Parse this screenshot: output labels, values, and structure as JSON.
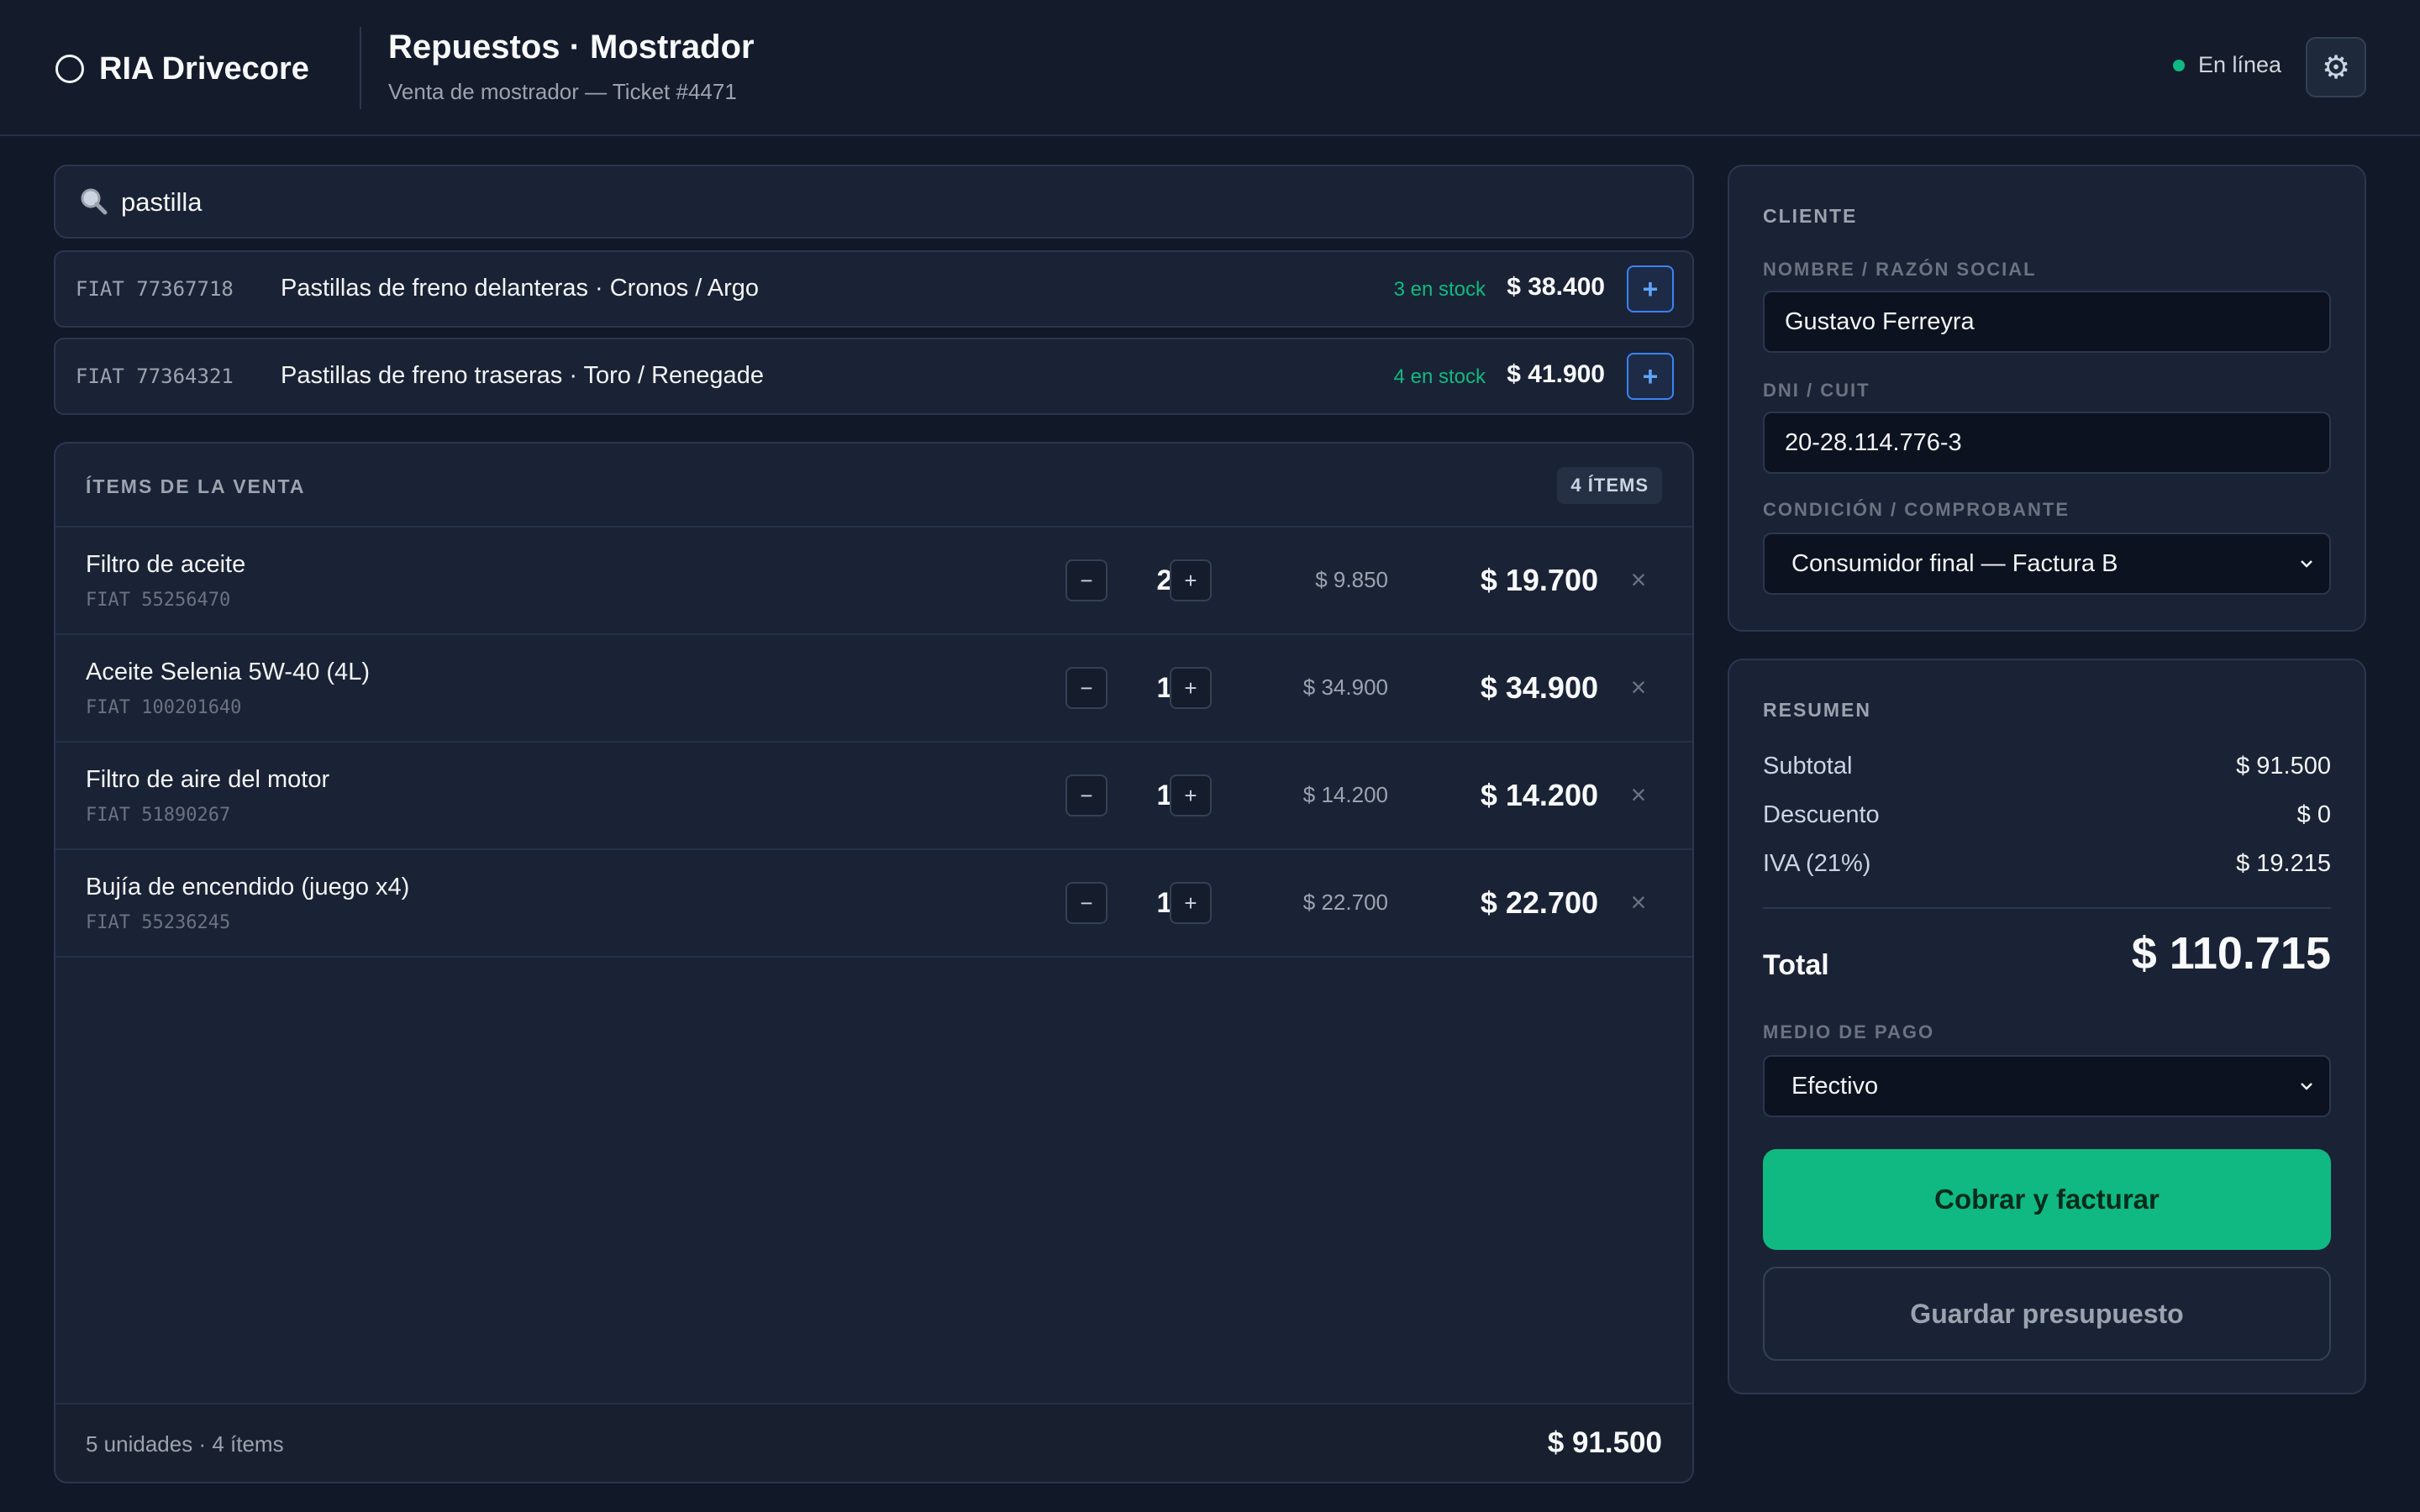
{
  "header": {
    "brand": "RIA Drivecore",
    "title": "Repuestos · Mostrador",
    "subtitle": "Venta de mostrador — Ticket #4471",
    "status": "En línea"
  },
  "search": {
    "value": "pastilla"
  },
  "results": [
    {
      "sku": "FIAT 77367718",
      "desc": "Pastillas de freno delanteras · Cronos / Argo",
      "stock": "3 en stock",
      "price": "$ 38.400",
      "add_label": "+"
    },
    {
      "sku": "FIAT 77364321",
      "desc": "Pastillas de freno traseras · Toro / Renegade",
      "stock": "4 en stock",
      "price": "$ 41.900",
      "add_label": "+"
    }
  ],
  "items": {
    "title": "ÍTEMS DE LA VENTA",
    "badge": "4 ÍTEMS",
    "rows": [
      {
        "name": "Filtro de aceite",
        "code": "FIAT 55256470",
        "qty": "2",
        "unit": "$ 9.850",
        "total": "$ 19.700"
      },
      {
        "name": "Aceite Selenia 5W-40 (4L)",
        "code": "FIAT 100201640",
        "qty": "1",
        "unit": "$ 34.900",
        "total": "$ 34.900"
      },
      {
        "name": "Filtro de aire del motor",
        "code": "FIAT 51890267",
        "qty": "1",
        "unit": "$ 14.200",
        "total": "$ 14.200"
      },
      {
        "name": "Bujía de encendido (juego x4)",
        "code": "FIAT 55236245",
        "qty": "1",
        "unit": "$ 22.700",
        "total": "$ 22.700"
      }
    ],
    "minus": "−",
    "plus": "+",
    "remove": "×",
    "footer_left": "5 unidades · 4 ítems",
    "footer_right": "$ 91.500"
  },
  "client": {
    "title": "CLIENTE",
    "name_label": "NOMBRE / RAZÓN SOCIAL",
    "name_value": "Gustavo Ferreyra",
    "dni_label": "DNI / CUIT",
    "dni_value": "20-28.114.776-3",
    "cond_label": "CONDICIÓN / COMPROBANTE",
    "cond_value": "Consumidor final — Factura B"
  },
  "summary": {
    "title": "RESUMEN",
    "subtotal_label": "Subtotal",
    "subtotal": "$ 91.500",
    "discount_label": "Descuento",
    "discount": "$ 0",
    "iva_label": "IVA (21%)",
    "iva": "$ 19.215",
    "total_label": "Total",
    "total": "$ 110.715",
    "payment_label": "MEDIO DE PAGO",
    "payment_value": "Efectivo",
    "charge_button": "Cobrar y facturar",
    "save_button": "Guardar presupuesto"
  },
  "colors": {
    "accent": "#10b981",
    "link": "#3b82f6",
    "background": "#111827"
  }
}
